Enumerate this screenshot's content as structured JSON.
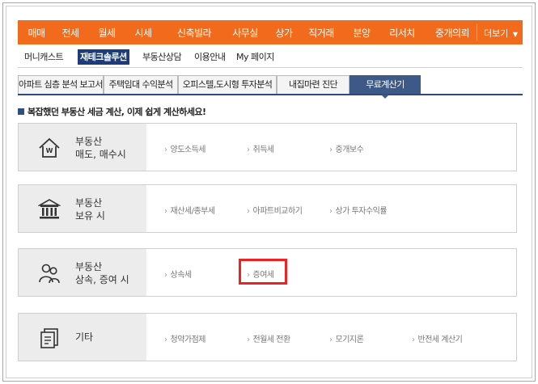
{
  "top_nav": {
    "items": [
      "매매",
      "전세",
      "월세",
      "시세",
      "신축빌라",
      "사무실",
      "상가",
      "직거래",
      "분양",
      "리서치",
      "중개의뢰"
    ],
    "more": "더보기"
  },
  "sub_nav": {
    "items": [
      "머니캐스트",
      "재테크솔루션",
      "부동산상담",
      "이용안내",
      "My 페이지"
    ]
  },
  "tabs": [
    "아파트 심층 분석 보고서",
    "주택임대 수익분석",
    "오피스텔,도시형 투자분석",
    "내집마련 진단",
    "무료계산기"
  ],
  "notice": "복잡했던 부동산 세금 계산, 이제 쉽게 계산하세요!",
  "categories": [
    {
      "title_line1": "부동산",
      "title_line2": "매도, 매수시",
      "icon": "house-won-icon",
      "links": [
        "양도소득세",
        "취득세",
        "중개보수"
      ]
    },
    {
      "title_line1": "부동산",
      "title_line2": "보유 시",
      "icon": "bank-building-icon",
      "links": [
        "재산세/종부세",
        "아파트비교하기",
        "상가 투자수익률"
      ]
    },
    {
      "title_line1": "부동산",
      "title_line2": "상속, 증여 시",
      "icon": "people-icon",
      "links": [
        "상속세",
        "증여세"
      ]
    },
    {
      "title_line1": "기타",
      "title_line2": "",
      "icon": "document-icon",
      "links": [
        "청약가점제",
        "전월세 전환",
        "모기지론",
        "반전세 계산기"
      ]
    }
  ],
  "colors": {
    "top_nav_bg": "#f26a1b",
    "active_sub_bg": "#1d3c79",
    "active_tab_bg": "#3d5987",
    "highlight_border": "#ee2222"
  }
}
